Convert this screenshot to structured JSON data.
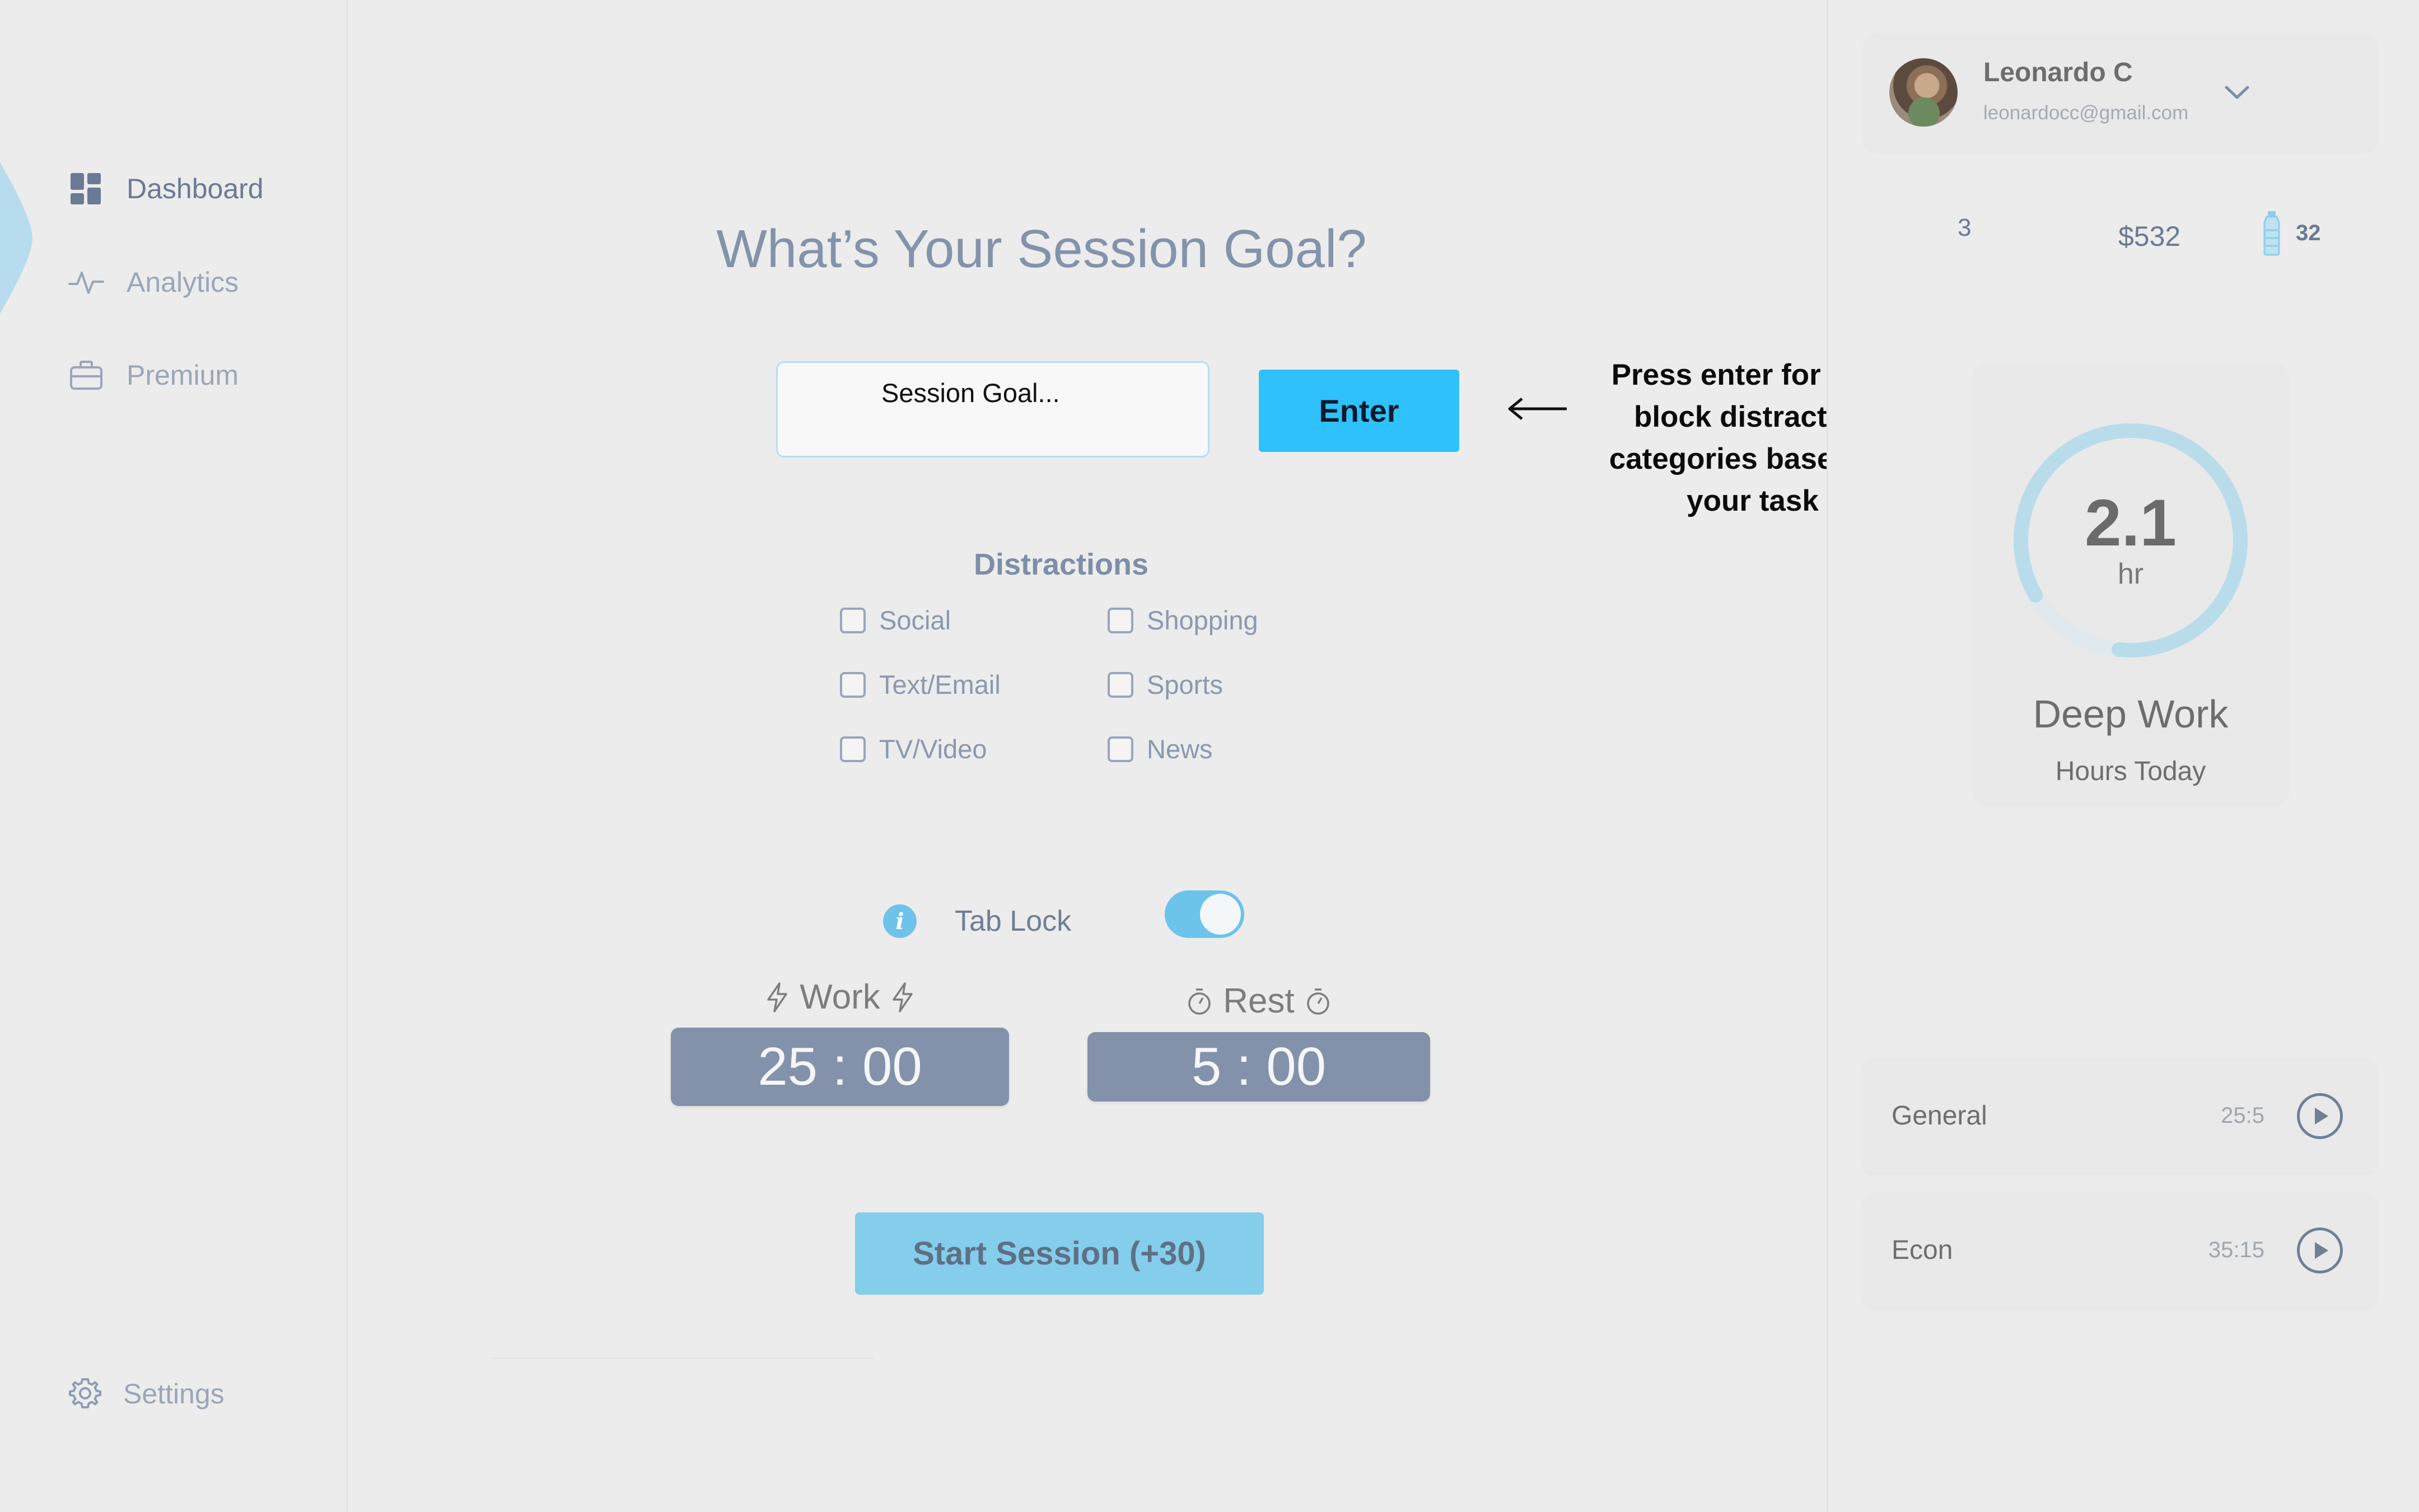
{
  "sidebar": {
    "items": [
      {
        "label": "Dashboard",
        "icon": "dashboard-icon"
      },
      {
        "label": "Analytics",
        "icon": "analytics-icon"
      },
      {
        "label": "Premium",
        "icon": "briefcase-icon"
      }
    ],
    "settings_label": "Settings"
  },
  "main": {
    "title": "What’s Your Session Goal?",
    "goal_placeholder": "Session Goal...",
    "enter_label": "Enter",
    "hint": "Press enter for AI to block distraction categories based on your task",
    "distractions_title": "Distractions",
    "distractions": [
      {
        "label": "Social",
        "checked": false
      },
      {
        "label": "Shopping",
        "checked": false
      },
      {
        "label": "Text/Email",
        "checked": false
      },
      {
        "label": "Sports",
        "checked": false
      },
      {
        "label": "TV/Video",
        "checked": false
      },
      {
        "label": "News",
        "checked": false
      }
    ],
    "tab_lock_label": "Tab Lock",
    "tab_lock_on": true,
    "work_label": "Work",
    "work_time": "25 : 00",
    "rest_label": "Rest",
    "rest_time": "5 : 00",
    "start_label": "Start Session (+30)"
  },
  "user": {
    "name": "Leonardo C",
    "email": "leonardocc@gmail.com"
  },
  "stats": {
    "count": "3",
    "money": "$532",
    "water": "32"
  },
  "deep_work": {
    "value": "2.1",
    "unit": "hr",
    "title": "Deep Work",
    "subtitle": "Hours Today",
    "ring_fill": 0.85
  },
  "sessions": [
    {
      "name": "General",
      "time": "25:5"
    },
    {
      "name": "Econ",
      "time": "35:15"
    }
  ],
  "colors": {
    "accent": "#2fc1fb",
    "start_button": "#84cdeb",
    "timer": "#8392aa",
    "ring": "#b9dcea"
  }
}
